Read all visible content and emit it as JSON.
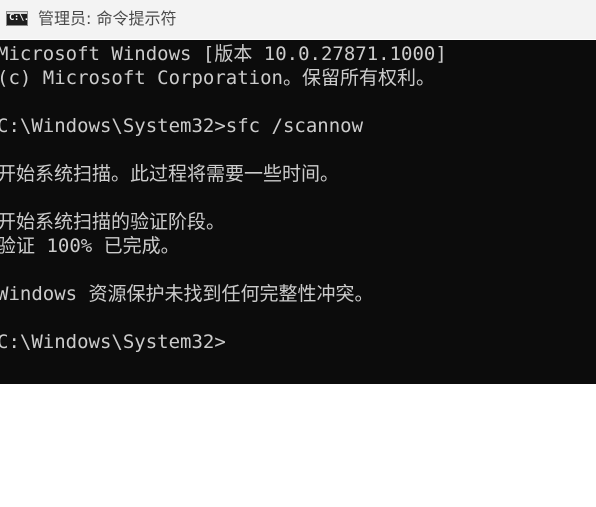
{
  "titlebar": {
    "icon": "cmd-icon",
    "icon_text": "C:\\.",
    "title": "管理员: 命令提示符"
  },
  "console": {
    "lines": [
      "Microsoft Windows [版本 10.0.27871.1000]",
      "(c) Microsoft Corporation。保留所有权利。",
      "",
      "C:\\Windows\\System32>sfc /scannow",
      "",
      "开始系统扫描。此过程将需要一些时间。",
      "",
      "开始系统扫描的验证阶段。",
      "验证 100% 已完成。",
      "",
      "Windows 资源保护未找到任何完整性冲突。",
      "",
      "C:\\Windows\\System32>"
    ]
  }
}
